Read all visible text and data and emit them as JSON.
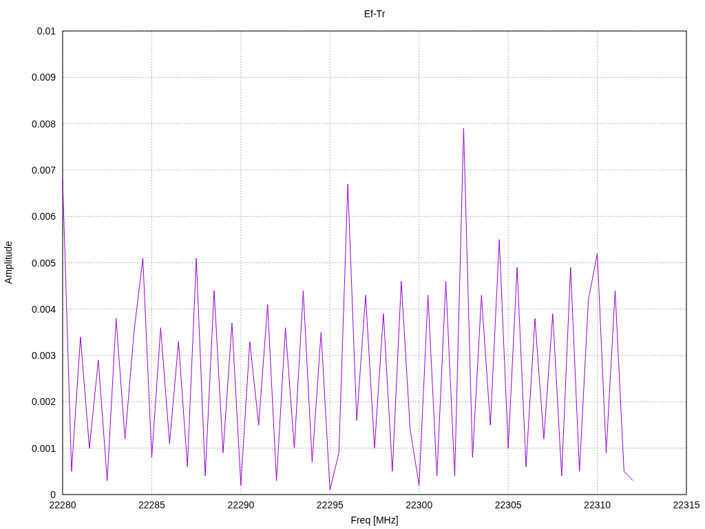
{
  "chart_data": {
    "type": "line",
    "title": "Ef-Tr",
    "xlabel": "Freq [MHz]",
    "ylabel": "Amplitude",
    "xlim": [
      22280,
      22315
    ],
    "ylim": [
      0,
      0.01
    ],
    "xticks": [
      22280,
      22285,
      22290,
      22295,
      22300,
      22305,
      22310,
      22315
    ],
    "yticks": [
      {
        "value": 0,
        "label": "0"
      },
      {
        "value": 0.001,
        "label": "0.001"
      },
      {
        "value": 0.002,
        "label": "0.002"
      },
      {
        "value": 0.003,
        "label": "0.003"
      },
      {
        "value": 0.004,
        "label": "0.004"
      },
      {
        "value": 0.005,
        "label": "0.005"
      },
      {
        "value": 0.006,
        "label": "0.006"
      },
      {
        "value": 0.007,
        "label": "0.007"
      },
      {
        "value": 0.008,
        "label": "0.008"
      },
      {
        "value": 0.009,
        "label": "0.009"
      },
      {
        "value": 0.01,
        "label": "0.01"
      }
    ],
    "x": [
      22280,
      22280.5,
      22281,
      22281.5,
      22282,
      22282.5,
      22283,
      22283.5,
      22284,
      22284.5,
      22285,
      22285.5,
      22286,
      22286.5,
      22287,
      22287.5,
      22288,
      22288.5,
      22289,
      22289.5,
      22290,
      22290.5,
      22291,
      22291.5,
      22292,
      22292.5,
      22293,
      22293.5,
      22294,
      22294.5,
      22295,
      22295.5,
      22296,
      22296.5,
      22297,
      22297.5,
      22298,
      22298.5,
      22299,
      22299.5,
      22300,
      22300.5,
      22301,
      22301.5,
      22302,
      22302.5,
      22303,
      22303.5,
      22304,
      22304.5,
      22305,
      22305.5,
      22306,
      22306.5,
      22307,
      22307.5,
      22308,
      22308.5,
      22309,
      22309.5,
      22310,
      22310.5,
      22311,
      22311.5,
      22312
    ],
    "grid": true,
    "series": [
      {
        "color": "#9400d3",
        "values": [
          0.0068,
          0.0005,
          0.0034,
          0.001,
          0.0029,
          0.0003,
          0.0038,
          0.0012,
          0.0035,
          0.0051,
          0.0008,
          0.0036,
          0.0011,
          0.0033,
          0.0006,
          0.0051,
          0.0004,
          0.0044,
          0.0009,
          0.0037,
          0.0002,
          0.0033,
          0.0015,
          0.0041,
          0.0003,
          0.0036,
          0.001,
          0.0044,
          0.0007,
          0.0035,
          0.0001,
          0.0009,
          0.0067,
          0.0016,
          0.0043,
          0.001,
          0.0039,
          0.0005,
          0.0046,
          0.0014,
          0.0002,
          0.0043,
          0.0004,
          0.0046,
          0.0004,
          0.0079,
          0.0008,
          0.0043,
          0.0015,
          0.0055,
          0.001,
          0.0049,
          0.0006,
          0.0038,
          0.0012,
          0.0039,
          0.0004,
          0.0049,
          0.0005,
          0.0042,
          0.0052,
          0.0009,
          0.0044,
          0.0005,
          0.0003
        ]
      }
    ]
  }
}
